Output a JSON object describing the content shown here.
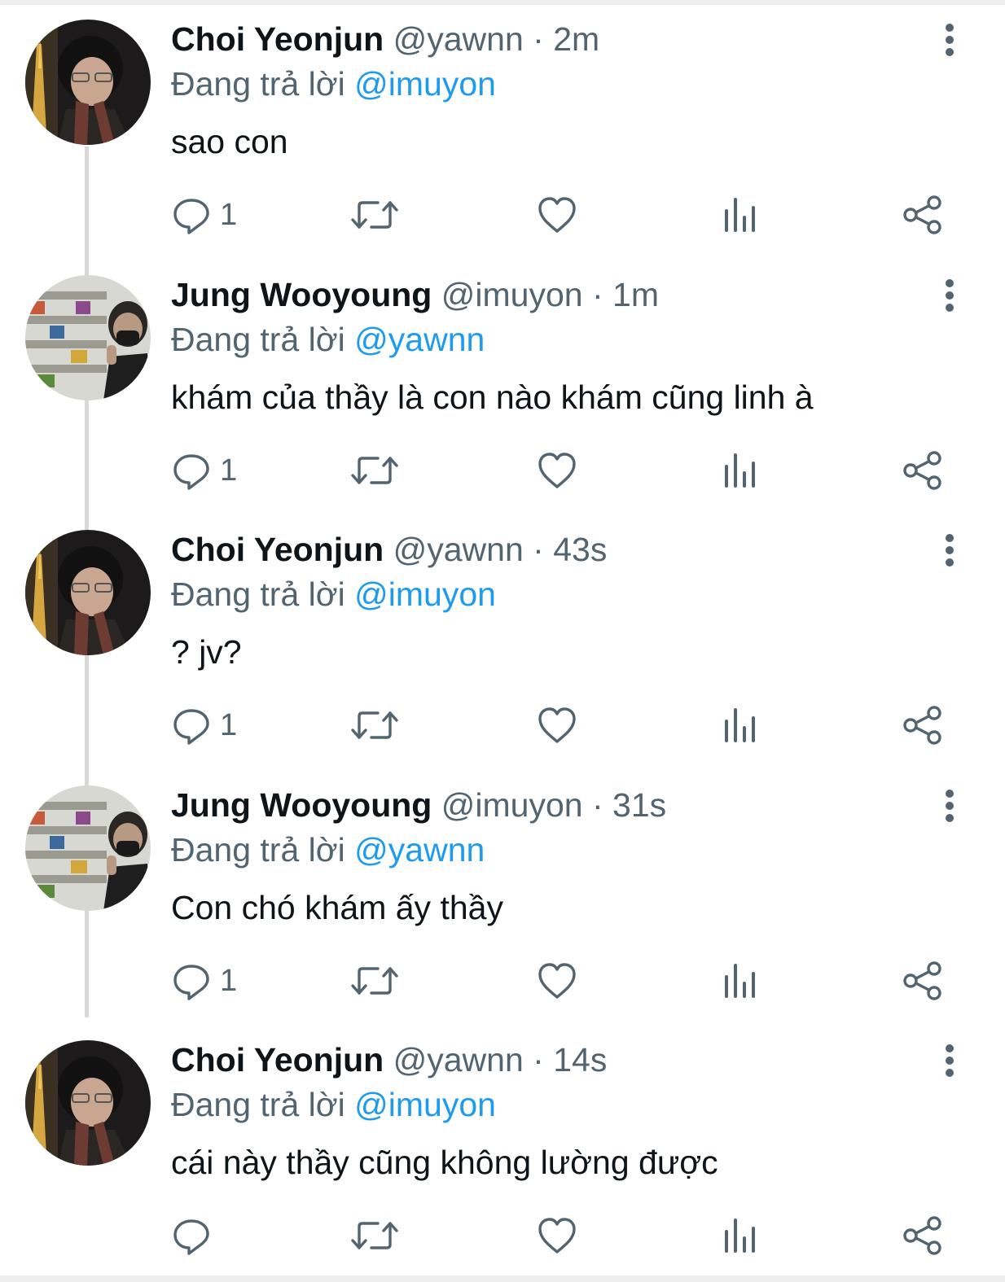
{
  "tweets": [
    {
      "author": "Choi Yeonjun",
      "handle": "@yawnn",
      "separator": "·",
      "time": "2m",
      "reply_prefix": "Đang trả lời",
      "reply_to": "@imuyon",
      "text": "sao con",
      "reply_count": "1",
      "avatar_icon": "avatar-yeonjun"
    },
    {
      "author": "Jung Wooyoung",
      "handle": "@imuyon",
      "separator": "·",
      "time": "1m",
      "reply_prefix": "Đang trả lời",
      "reply_to": "@yawnn",
      "text": "khám của thầy là con nào khám cũng linh à",
      "reply_count": "1",
      "avatar_icon": "avatar-wooyoung"
    },
    {
      "author": "Choi Yeonjun",
      "handle": "@yawnn",
      "separator": "·",
      "time": "43s",
      "reply_prefix": "Đang trả lời",
      "reply_to": "@imuyon",
      "text": "? jv?",
      "reply_count": "1",
      "avatar_icon": "avatar-yeonjun"
    },
    {
      "author": "Jung Wooyoung",
      "handle": "@imuyon",
      "separator": "·",
      "time": "31s",
      "reply_prefix": "Đang trả lời",
      "reply_to": "@yawnn",
      "text": "Con chó khám ấy thầy",
      "reply_count": "1",
      "avatar_icon": "avatar-wooyoung"
    },
    {
      "author": "Choi Yeonjun",
      "handle": "@yawnn",
      "separator": "·",
      "time": "14s",
      "reply_prefix": "Đang trả lời",
      "reply_to": "@imuyon",
      "text": "cái này thầy cũng không lường được",
      "reply_count": "",
      "avatar_icon": "avatar-yeonjun"
    }
  ],
  "icons": {
    "reply": "reply-icon",
    "retweet": "retweet-icon",
    "like": "heart-icon",
    "views": "views-icon",
    "share": "share-icon",
    "more": "more-options-icon"
  },
  "colors": {
    "accent": "#1d9bf0",
    "secondary_text": "#536471",
    "primary_text": "#0f1419",
    "thread_line": "#d9d9d9"
  }
}
